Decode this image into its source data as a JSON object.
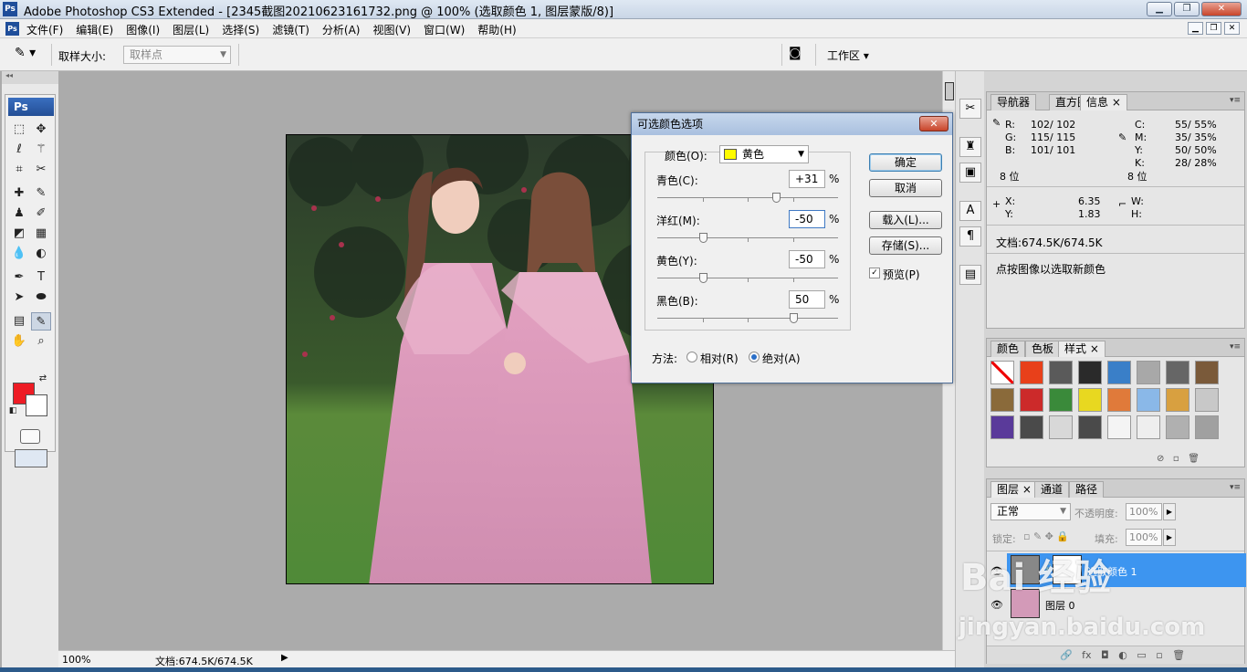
{
  "window": {
    "title": "Adobe Photoshop CS3 Extended - [2345截图20210623161732.png @ 100% (选取颜色 1, 图层蒙版/8)]",
    "logo": "Ps",
    "buttons": {
      "minimize": "▁",
      "restore": "❐",
      "close": "✕"
    }
  },
  "menu": [
    "文件(F)",
    "编辑(E)",
    "图像(I)",
    "图层(L)",
    "选择(S)",
    "滤镜(T)",
    "分析(A)",
    "视图(V)",
    "窗口(W)",
    "帮助(H)"
  ],
  "options": {
    "sample_size_label": "取样大小:",
    "sample_size_value": "取样点",
    "workspace_label": "工作区 ▾"
  },
  "toolbox": {
    "logo": "Ps"
  },
  "statusbar": {
    "zoom": "100%",
    "doc": "文档:674.5K/674.5K"
  },
  "info_panel": {
    "tabs": [
      "导航器",
      "直方图",
      "信息"
    ],
    "rgb": {
      "R": "102/ 102",
      "G": "115/ 115",
      "B": "101/ 101"
    },
    "cmyk": {
      "C": "55/ 55%",
      "M": "35/ 35%",
      "Y": "50/ 50%",
      "K": "28/ 28%"
    },
    "bits_left": "8 位",
    "bits_right": "8 位",
    "x_label": "X:",
    "x": "6.35",
    "y_label": "Y:",
    "y": "1.83",
    "w_label": "W:",
    "h_label": "H:",
    "doc": "文档:674.5K/674.5K",
    "hint": "点按图像以选取新颜色"
  },
  "styles_panel": {
    "tabs": [
      "颜色",
      "色板",
      "样式"
    ],
    "swatch_colors": [
      "#ffffff",
      "#e8401a",
      "#5a5a5a",
      "#2a2a2a",
      "#3a7fc8",
      "#a8a8a8",
      "#666666",
      "#7a5a3a",
      "#8a6a3a",
      "#cc2a2a",
      "#3a8a3a",
      "#e8d820",
      "#e07a3a",
      "#8ab8e8",
      "#d8a040",
      "#c8c8c8",
      "#5a3a9a",
      "#4a4a4a",
      "#d8d8d8",
      "#4a4a4a",
      "#f4f4f4",
      "#eeeeee",
      "#b0b0b0",
      "#a0a0a0"
    ]
  },
  "layers_panel": {
    "tabs": [
      "图层",
      "通道",
      "路径"
    ],
    "blend_mode": "正常",
    "opacity_label": "不透明度:",
    "opacity": "100%",
    "lock_label": "锁定:",
    "fill_label": "填充:",
    "fill": "100%",
    "layers": [
      {
        "name": "选取颜色 1"
      },
      {
        "name": "图层 0"
      }
    ]
  },
  "dialog": {
    "title": "可选颜色选项",
    "colors_label": "颜色(O):",
    "colors_value": "黄色",
    "sliders": [
      {
        "label": "青色(C):",
        "value": "+31",
        "pct": 0.655
      },
      {
        "label": "洋红(M):",
        "value": "-50",
        "pct": 0.25
      },
      {
        "label": "黄色(Y):",
        "value": "-50",
        "pct": 0.25
      },
      {
        "label": "黑色(B):",
        "value": "50",
        "pct": 0.75
      }
    ],
    "percent": "%",
    "ok": "确定",
    "cancel": "取消",
    "load": "载入(L)...",
    "save": "存储(S)...",
    "preview": "预览(P)",
    "method_label": "方法:",
    "relative": "相对(R)",
    "absolute": "绝对(A)"
  },
  "watermark": {
    "brand": "Bai  经验",
    "url": "jingyan.baidu.com"
  }
}
